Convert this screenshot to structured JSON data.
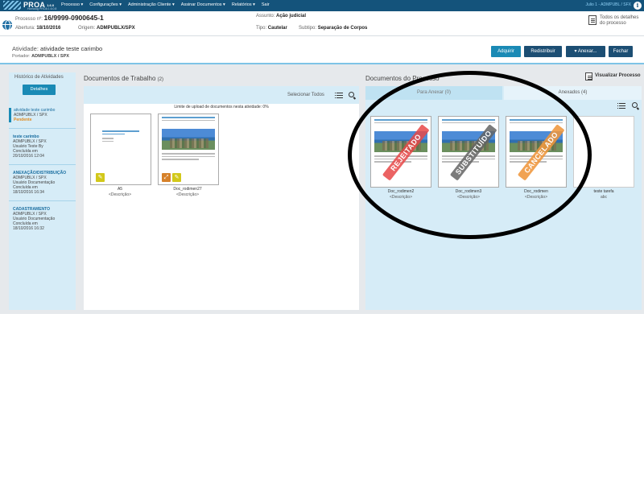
{
  "topbar": {
    "logo": "PROA",
    "logo_version": "1.6.0",
    "logo_sub": "Homolog PROA 1.6.0.8",
    "nav": [
      "Processo ▾",
      "Configurações ▾",
      "Administração Cliente ▾",
      "Assinar Documentos ▾",
      "Relatórios ▾",
      "Sair"
    ],
    "user": "Julio 1 - ADMPUBL / SFX",
    "info_icon": "i"
  },
  "process": {
    "number_label": "Processo nº:",
    "number": "16/9999-0900645-1",
    "opening_label": "Abertura:",
    "opening": "18/10/2016",
    "origin_label": "Origem:",
    "origin": "ADMPUBLX/SPX",
    "subject_label": "Assunto:",
    "subject": "Ação judicial",
    "type_label": "Tipo:",
    "type": "Cautelar",
    "subtype_label": "Subtipo:",
    "subtype": "Separação de Corpos",
    "details_link": "Todos os detalhes do processo"
  },
  "activity": {
    "title_label": "Atividade:",
    "title": "atividade teste carimbo",
    "holder_label": "Portador:",
    "holder": "ADMPUBLX / SPX",
    "buttons": {
      "adquirir": "Adquirir",
      "redistribuir": "Redistribuir",
      "anexar": "▾ Anexar...",
      "fechar": "Fechar"
    }
  },
  "history": {
    "title": "Histórico de Atividades",
    "details_button": "Detalhes",
    "items": [
      {
        "title": "atividade teste carimbo",
        "lines": [
          "ADMPUBLX / SPX"
        ],
        "status": "Pendente"
      },
      {
        "title": "teste carimbo",
        "lines": [
          "ADMPUBLX / SPX",
          "Usuário Teste By",
          "Concluída em",
          "20/10/2016 12:04"
        ]
      },
      {
        "title": "ANEXAÇÃO/DISTRIBUIÇÃO",
        "lines": [
          "ADMPUBLX / SPX",
          "Usuário Documentação",
          "Concluída em",
          "18/10/2016 16:34"
        ]
      },
      {
        "title": "CADASTRAMENTO",
        "lines": [
          "ADMPUBLX / SPX",
          "Usuário Documentação",
          "Concluída em",
          "18/10/2016 16:32"
        ]
      }
    ]
  },
  "work_docs": {
    "title": "Documentos de Trabalho",
    "count": "(2)",
    "select_all": "Selecionar Todos",
    "upload_limit": "Limite de upload de documentos nesta atividade: 0%",
    "docs": [
      {
        "name": "A5",
        "description": "<Descrição>",
        "badges": [
          "comment"
        ]
      },
      {
        "name": "Doc_rodimen27",
        "description": "<Descrição>",
        "badges": [
          "expand",
          "comment"
        ]
      }
    ]
  },
  "process_docs": {
    "title": "Documentos do Processo",
    "view_process": "Visualizar Processo",
    "tabs": {
      "para_anexar": "Para Anexar (0)",
      "anexados": "Anexados (4)"
    },
    "docs": [
      {
        "name": "Doc_rodimen2",
        "description": "<Descrição>",
        "stamp": "REJEITADO"
      },
      {
        "name": "Doc_rodimen3",
        "description": "<Descrição>",
        "stamp": "SUBSTITUÍDO"
      },
      {
        "name": "Doc_rodimen",
        "description": "<Descrição>",
        "stamp": "CANCELADO"
      },
      {
        "name": "teste tarefa",
        "description": "abc",
        "stamp": ""
      }
    ]
  },
  "icons": [
    "globe-icon",
    "document-icon",
    "list-view-icon",
    "search-icon",
    "comment-icon",
    "expand-icon",
    "info-icon"
  ],
  "colors": {
    "nav": "#14537b",
    "primary_button": "#1a8ab5",
    "dark_button": "#1c4e73",
    "panel": "#d6ecf7",
    "status_pending": "#e08a1e",
    "stamp_rejected": "#e84848",
    "stamp_replaced": "#646464",
    "stamp_cancelled": "#ef963c"
  }
}
